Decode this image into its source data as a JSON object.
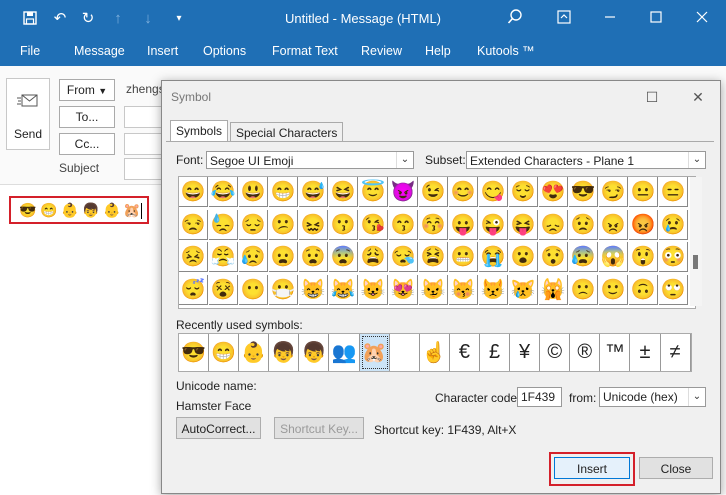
{
  "window": {
    "title": "Untitled  -  Message (HTML)",
    "quick_access": [
      "save-icon",
      "undo-icon",
      "redo-icon",
      "up-arrow-icon",
      "down-arrow-icon",
      "dropdown-icon"
    ]
  },
  "ribbon": {
    "tabs": [
      "File",
      "Message",
      "Insert",
      "Options",
      "Format Text",
      "Review",
      "Help",
      "Kutools ™"
    ]
  },
  "compose": {
    "send_label": "Send",
    "from_label": "From",
    "from_value": "zhengs",
    "to_label": "To...",
    "cc_label": "Cc...",
    "subject_label": "Subject",
    "body_emojis": [
      "😎",
      "😁",
      "👶",
      "👦",
      "👶",
      "🐹"
    ]
  },
  "dialog": {
    "title": "Symbol",
    "tabs": [
      "Symbols",
      "Special Characters"
    ],
    "font_label": "Font:",
    "font_value": "Segoe UI Emoji",
    "subset_label": "Subset:",
    "subset_value": "Extended Characters - Plane 1",
    "symbol_grid": [
      [
        "😄",
        "😂",
        "😃",
        "😁",
        "😅",
        "😆",
        "😇",
        "😈",
        "😉",
        "😊",
        "😋",
        "😌",
        "😍",
        "😎",
        "😏",
        "😐",
        "😑"
      ],
      [
        "😒",
        "😓",
        "😔",
        "😕",
        "😖",
        "😗",
        "😘",
        "😙",
        "😚",
        "😛",
        "😜",
        "😝",
        "😞",
        "😟",
        "😠",
        "😡",
        "😢"
      ],
      [
        "😣",
        "😤",
        "😥",
        "😦",
        "😧",
        "😨",
        "😩",
        "😪",
        "😫",
        "😬",
        "😭",
        "😮",
        "😯",
        "😰",
        "😱",
        "😲",
        "😳"
      ],
      [
        "😴",
        "😵",
        "😶",
        "😷",
        "😸",
        "😹",
        "😺",
        "😻",
        "😼",
        "😽",
        "😾",
        "😿",
        "🙀",
        "🙁",
        "🙂",
        "🙃",
        "🙄"
      ]
    ],
    "recent_label": "Recently used symbols:",
    "recent_symbols": [
      "😎",
      "😁",
      "👶",
      "👦",
      "👦",
      "👥",
      "🐹",
      "",
      "☝",
      "€",
      "£",
      "¥",
      "©",
      "®",
      "™",
      "±",
      "≠"
    ],
    "unicode_name_label": "Unicode name:",
    "unicode_name_value": "Hamster Face",
    "autocorrect_label": "AutoCorrect...",
    "shortcut_key_button": "Shortcut Key...",
    "shortcut_text": "Shortcut key: 1F439, Alt+X",
    "char_code_label": "Character code:",
    "char_code_value": "1F439",
    "from_label": "from:",
    "from_value": "Unicode (hex)",
    "insert_label": "Insert",
    "close_label": "Close"
  },
  "colors": {
    "accent": "#1f6fb5",
    "highlight": "#d4202a",
    "selected": "#cce4f7"
  }
}
